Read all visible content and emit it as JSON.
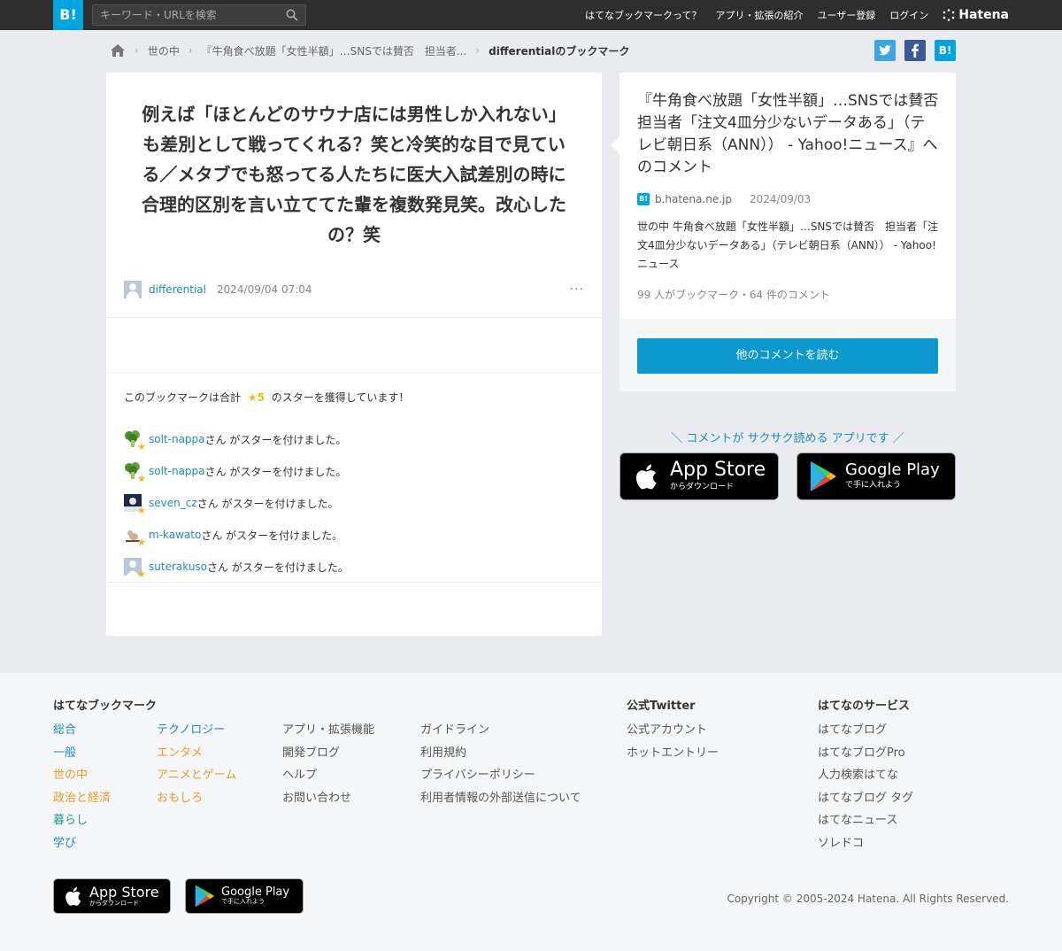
{
  "header": {
    "logo": "B!",
    "search_placeholder": "キーワード・URLを検索",
    "nav": [
      "はてなブックマークって？",
      "アプリ・拡張の紹介",
      "ユーザー登録",
      "ログイン"
    ],
    "brand": "Hatena"
  },
  "breadcrumb": {
    "items": [
      "世の中",
      "『牛角食べ放題「女性半額」…SNSでは賛否　担当者...",
      "differentialのブックマーク"
    ]
  },
  "share": {
    "twitter": "t",
    "facebook": "f",
    "hatena": "B!"
  },
  "bookmark": {
    "comment": "例えば「ほとんどのサウナ店には男性しか入れない」も差別として戦ってくれる？笑と冷笑的な目で見ている／メタブでも怒ってる人たちに医大入試差別の時に合理的区別を言い立ててた輩を複数発見笑。改心したの？笑",
    "user": "differential",
    "date": "2024/09/04 07:04",
    "more": "···"
  },
  "stars": {
    "summary_prefix": "このブックマークは合計",
    "summary_count": "★5",
    "summary_suffix": "のスターを獲得しています！",
    "suffix": "さん がスターを付けました。",
    "star_glyph": "★",
    "rows": [
      {
        "name": "solt-nappa"
      },
      {
        "name": "solt-nappa"
      },
      {
        "name": "seven_cz"
      },
      {
        "name": "m-kawato"
      },
      {
        "name": "suterakuso"
      }
    ]
  },
  "entry": {
    "title": "『牛角食べ放題「女性半額」…SNSでは賛否　担当者「注文4皿分少ないデータある」（テレビ朝日系（ANN）） - Yahoo!ニュース』へのコメント",
    "favicon": "B!",
    "domain": "b.hatena.ne.jp",
    "date": "2024/09/03",
    "desc": "世の中 牛角食べ放題「女性半額」…SNSでは賛否　担当者「注文4皿分少ないデータある」（テレビ朝日系（ANN）） - Yahoo!ニュース",
    "count": "99 人がブックマーク・64 件のコメント",
    "read_button": "他のコメントを読む"
  },
  "promo": {
    "text": "＼ コメントが サクサク読める アプリです ／",
    "app_store_big": "App Store",
    "app_store_small": "からダウンロード",
    "google_play_big": "Google Play",
    "google_play_small": "で手に入れよう"
  },
  "footer": {
    "hb_title": "はてなブックマーク",
    "cat1": [
      "総合",
      "一般",
      "世の中",
      "政治と経済",
      "暮らし",
      "学び"
    ],
    "cat2": [
      "テクノロジー",
      "エンタメ",
      "アニメとゲーム",
      "おもしろ"
    ],
    "links1": [
      "アプリ・拡張機能",
      "開発ブログ",
      "ヘルプ",
      "お問い合わせ"
    ],
    "links2": [
      "ガイドライン",
      "利用規約",
      "プライバシーポリシー",
      "利用者情報の外部送信について"
    ],
    "twitter_title": "公式Twitter",
    "twitter_links": [
      "公式アカウント",
      "ホットエントリー"
    ],
    "services_title": "はてなのサービス",
    "services": [
      "はてなブログ",
      "はてなブログPro",
      "人力検索はてな",
      "はてなブログ タグ",
      "はてなニュース",
      "ソレドコ"
    ],
    "copyright": "Copyright © 2005-2024 Hatena. All Rights Reserved."
  },
  "colors": {
    "accent": "#00a4de",
    "link": "#1a8dbf",
    "star": "#f5b61c",
    "button": "#0b98cf"
  }
}
